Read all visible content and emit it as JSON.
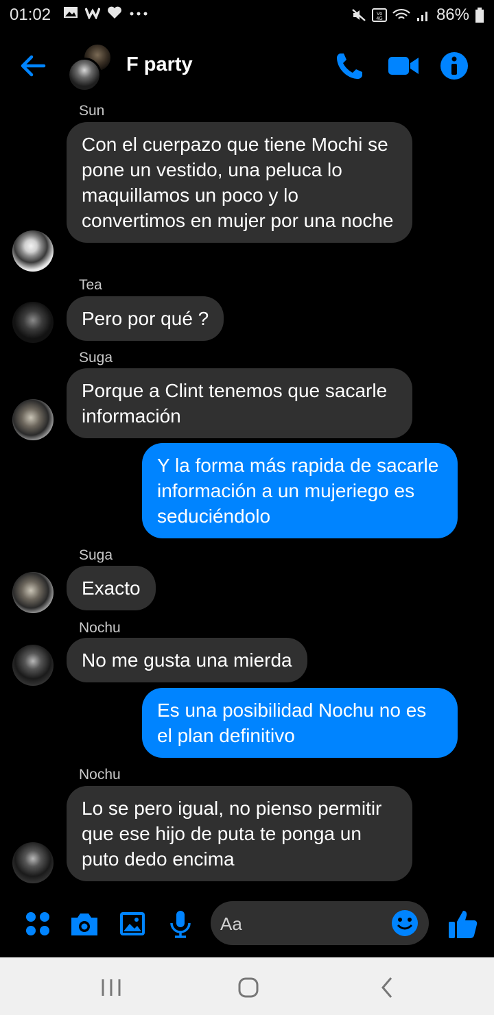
{
  "status_bar": {
    "time": "01:02",
    "battery": "86%"
  },
  "header": {
    "title": "F party"
  },
  "messages": [
    {
      "sender": "Sun",
      "text": "Con el cuerpazo que tiene Mochi se pone un vestido, una peluca lo maquillamos un poco y lo convertimos en mujer por una noche"
    },
    {
      "sender": "Tea",
      "text": "Pero por qué ?"
    },
    {
      "sender": "Suga",
      "text": "Porque a Clint tenemos que sacarle información"
    },
    {
      "sender": "",
      "text": "Y la forma más rapida de sacarle información a un mujeriego es seduciéndolo"
    },
    {
      "sender": "Suga",
      "text": "Exacto"
    },
    {
      "sender": "Nochu",
      "text": "No me gusta una mierda"
    },
    {
      "sender": "",
      "text": "Es una posibilidad Nochu no es el plan definitivo"
    },
    {
      "sender": "Nochu",
      "text": "Lo se pero igual, no pienso permitir que ese hijo de puta te ponga un puto dedo encima"
    }
  ],
  "composer": {
    "placeholder": "Aa"
  },
  "colors": {
    "accent": "#0084ff",
    "incoming_bubble": "#303030",
    "background": "#000000"
  }
}
